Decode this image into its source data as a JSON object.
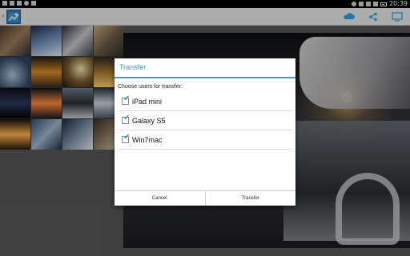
{
  "status_bar": {
    "time": "20:39",
    "icons": [
      "usb-icon",
      "sim-icon",
      "image-icon",
      "screenshot-icon",
      "notification-icon",
      "alarm-icon",
      "vibrate-icon",
      "wifi-icon",
      "signal-icon",
      "battery-icon"
    ]
  },
  "action_bar": {
    "up_caret": "‹",
    "actions": [
      "transfer-cloud-icon",
      "share-icon",
      "screen-cast-icon"
    ],
    "accent": "#2aa3d9"
  },
  "dialog": {
    "title": "Transfer",
    "subtitle": "Choose users for transfer:",
    "users": [
      {
        "label": "iPad mini",
        "checked": true
      },
      {
        "label": "Galaxy S5",
        "checked": true
      },
      {
        "label": "Win7mac",
        "checked": true
      }
    ],
    "cancel_label": "Cancel",
    "transfer_label": "Transfer"
  }
}
